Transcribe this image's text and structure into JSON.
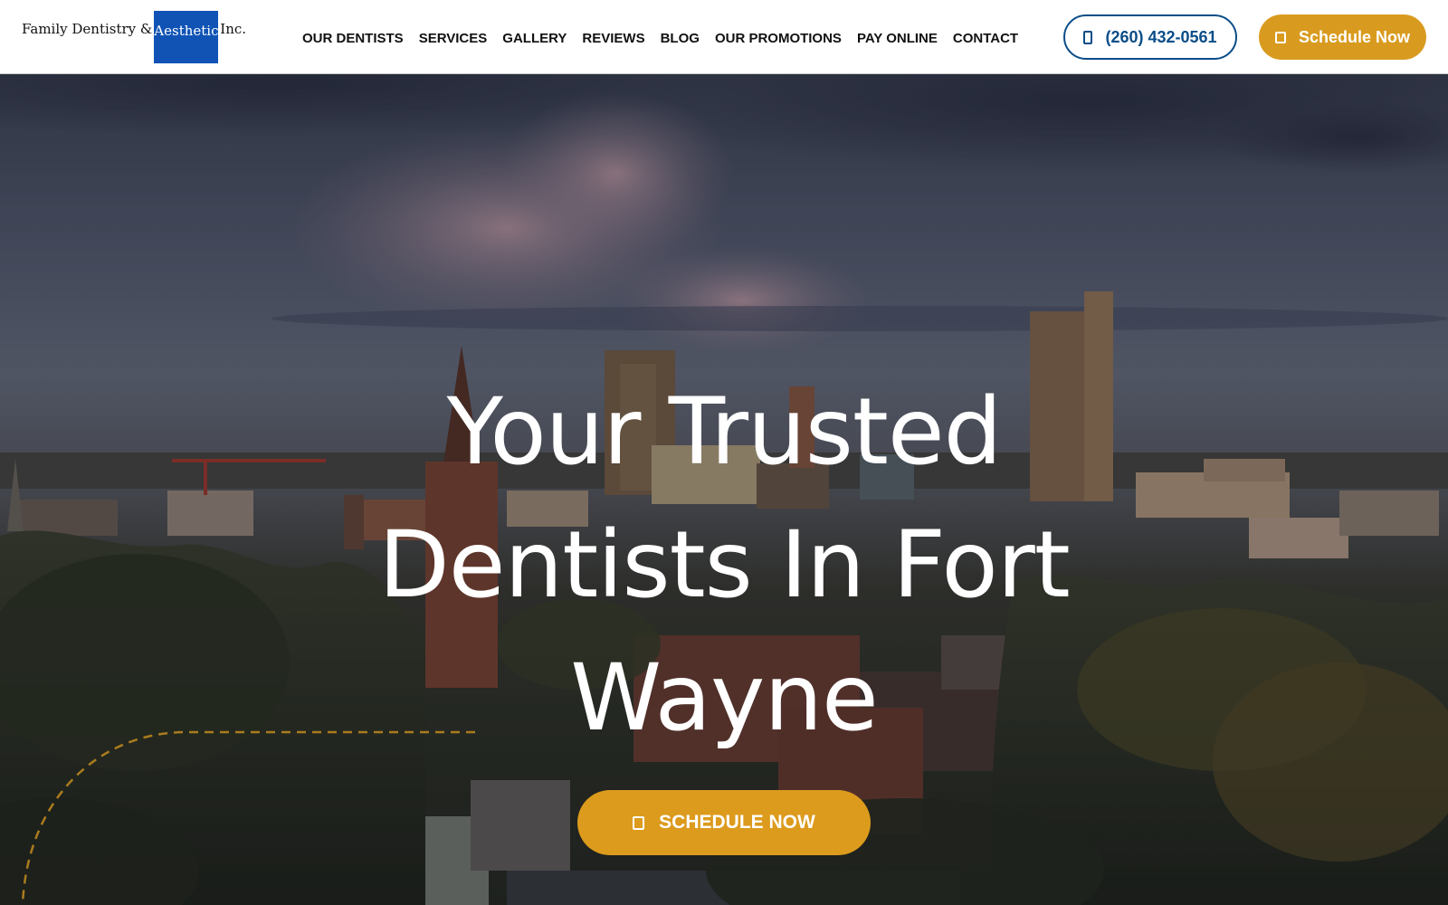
{
  "header": {
    "logo": {
      "text_before": "Family Dentistry &",
      "text_highlight": "Aesthetics",
      "text_after": "Inc.",
      "highlight_color": "#1053b5"
    },
    "nav": [
      {
        "label": "OUR DENTISTS"
      },
      {
        "label": "SERVICES"
      },
      {
        "label": "GALLERY"
      },
      {
        "label": "REVIEWS"
      },
      {
        "label": "BLOG"
      },
      {
        "label": "OUR PROMOTIONS"
      },
      {
        "label": "PAY ONLINE"
      },
      {
        "label": "CONTACT"
      }
    ],
    "phone_button": {
      "label": "(260) 432-0561",
      "icon": "phone-icon",
      "color": "#0b4d88"
    },
    "schedule_button": {
      "label": "Schedule Now",
      "icon": "calendar-icon",
      "color": "#d99b1f"
    }
  },
  "hero": {
    "title_lines": [
      "Your Trusted",
      "Dentists In Fort",
      "Wayne"
    ],
    "cta": {
      "label": "SCHEDULE NOW",
      "icon": "calendar-icon",
      "color": "#dc9b1d"
    },
    "background": "Fort Wayne city skyline at dusk",
    "accent_dash_color": "#e8a722"
  }
}
